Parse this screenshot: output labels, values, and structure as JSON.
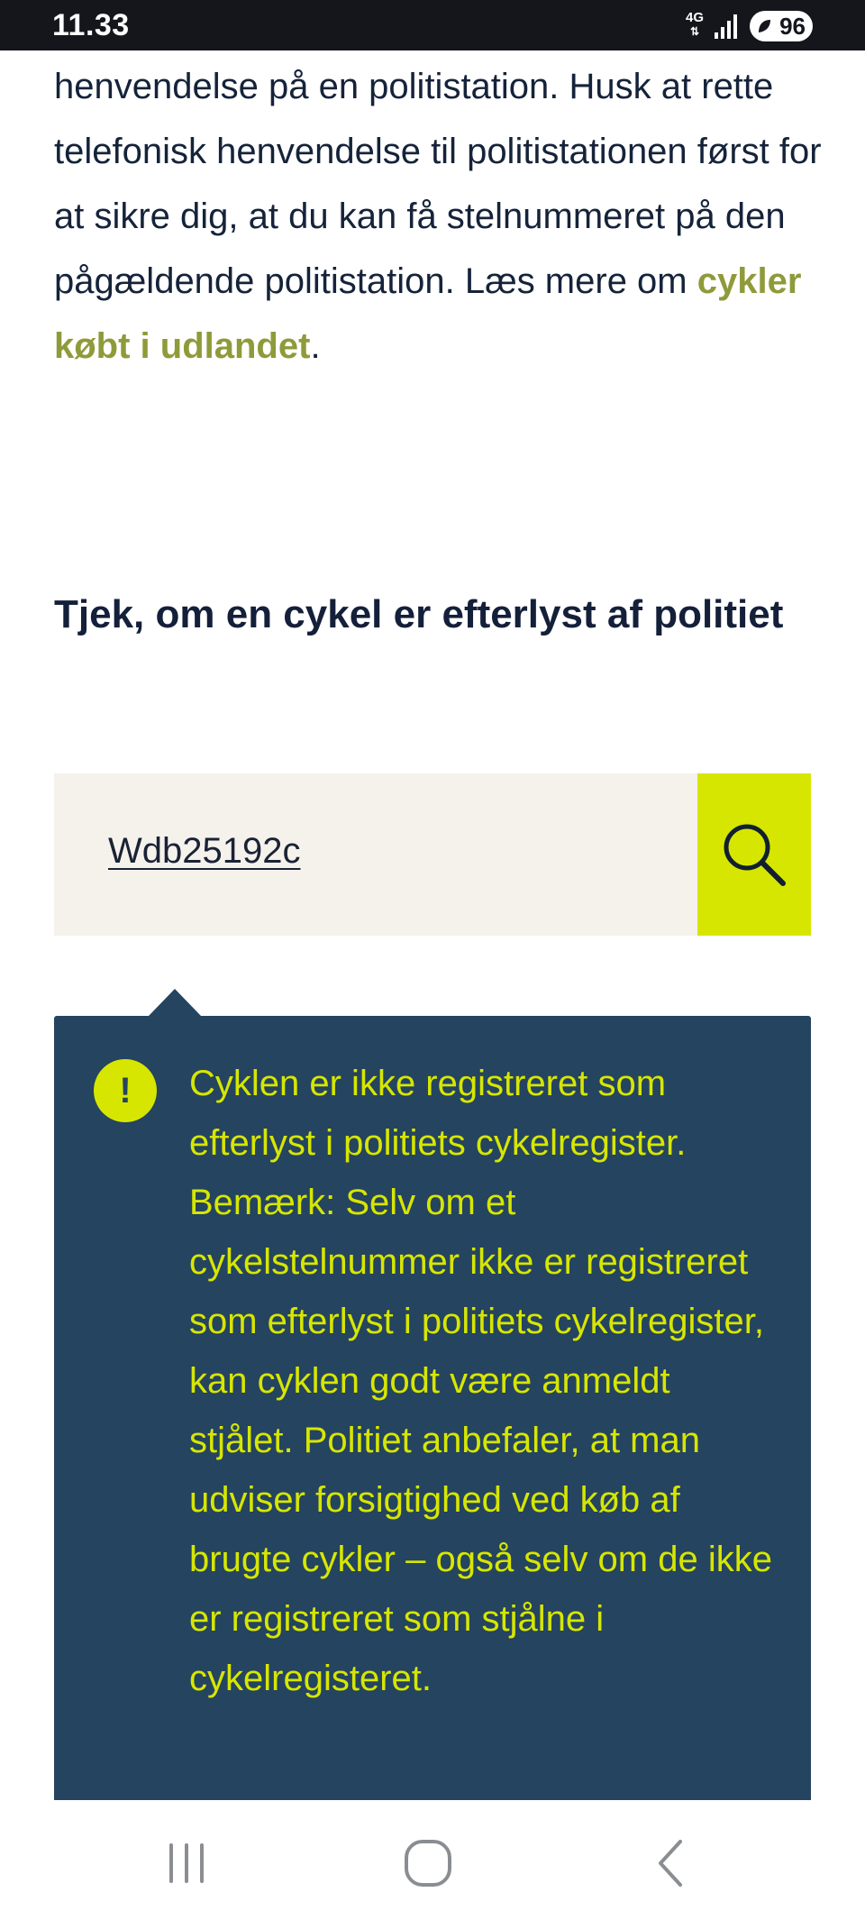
{
  "status_bar": {
    "time": "11.33",
    "network": "4G",
    "battery": "96"
  },
  "intro": {
    "text_before": "henvendelse på en politistation. Husk at rette telefonisk henvendelse til politistationen først for at sikre dig, at du kan få stelnummeret på den pågældende politistation. Læs mere om ",
    "link_label": "cykler købt i udlandet",
    "text_after": "."
  },
  "heading": "Tjek, om en cykel er efterlyst af politiet",
  "search": {
    "value": "Wdb25192c",
    "button_icon": "search-icon"
  },
  "result": {
    "icon": "!",
    "message": "Cyklen er ikke registreret som efterlyst i politiets cykelregister. Bemærk: Selv om et cykelstelnummer ikke er registreret som efterlyst i politiets cykelregister, kan cyklen godt være anmeldt stjålet. Politiet anbefaler, at man udviser forsigtighed ved køb af brugte cykler – også selv om de ikke er registreret som stjålne i cykelregisteret."
  },
  "navbar": {
    "recents_icon": "recents-icon",
    "home_icon": "home-icon",
    "back_icon": "back-icon"
  },
  "colors": {
    "accent_lime": "#d7e600",
    "panel_navy": "#24445f",
    "link_olive": "#8f9a3a",
    "search_bg": "#f5f2ec"
  }
}
